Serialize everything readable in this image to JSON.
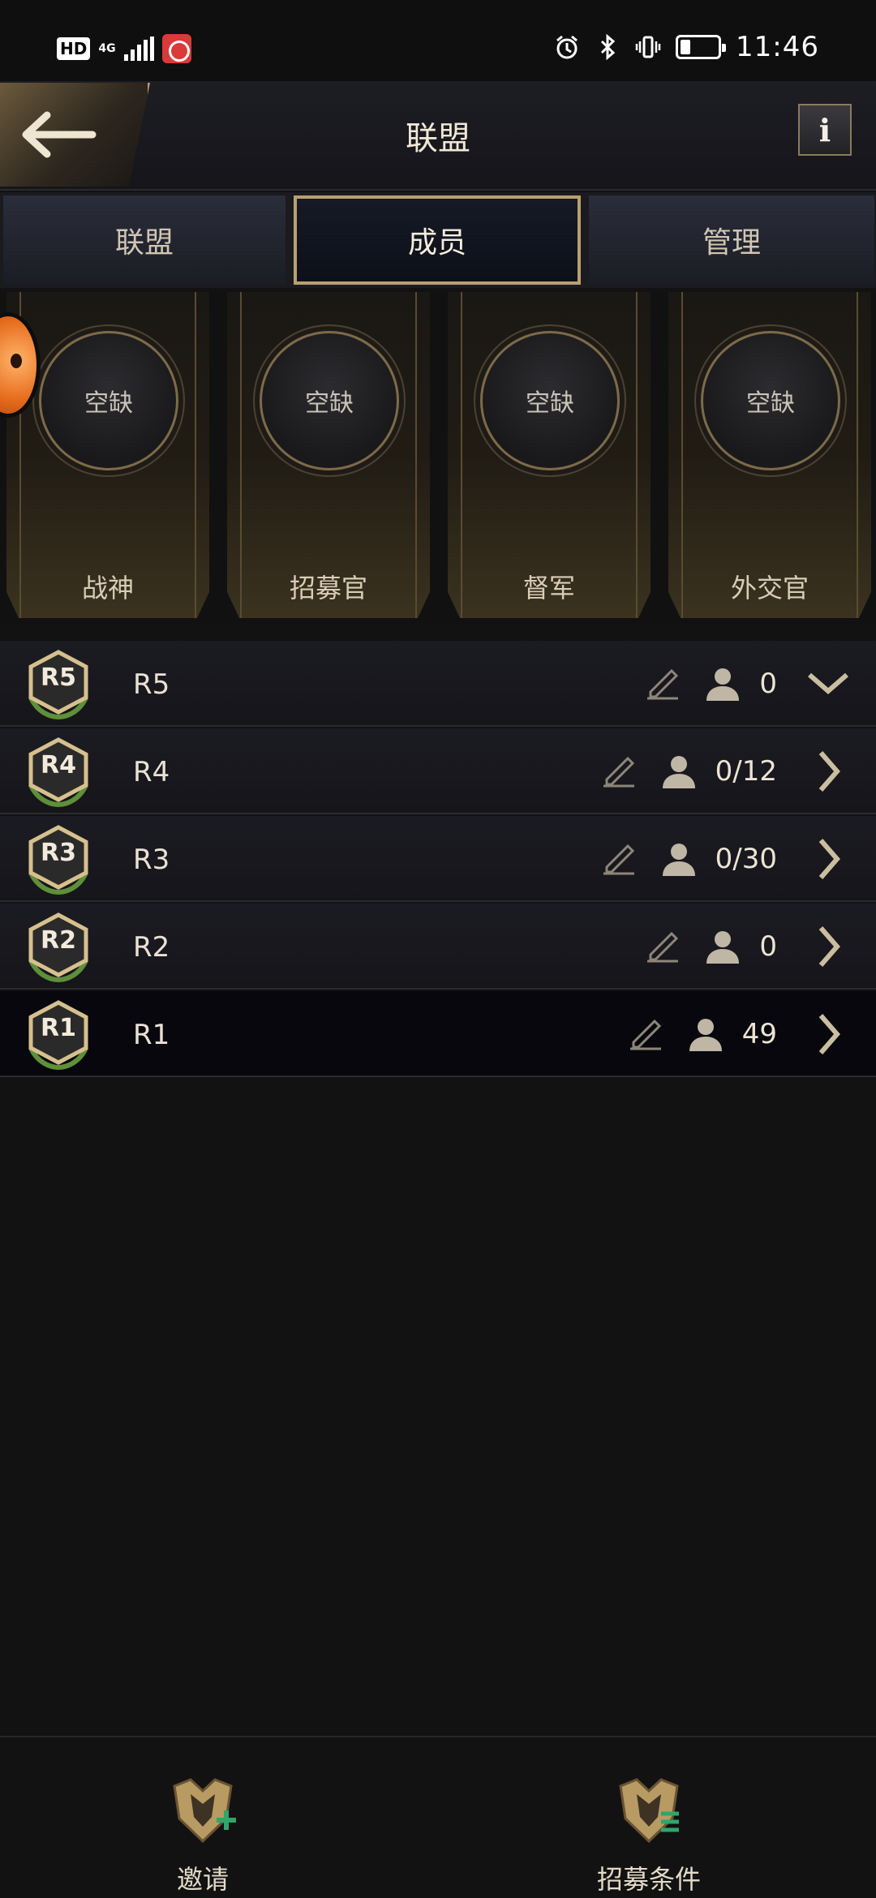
{
  "status_bar": {
    "hd": "HD",
    "network": "4G",
    "time": "11:46",
    "battery_level_percent": 20
  },
  "header": {
    "title": "联盟",
    "back_icon": "back-arrow-icon",
    "info_label": "i"
  },
  "tabs": [
    {
      "label": "联盟",
      "active": false
    },
    {
      "label": "成员",
      "active": true
    },
    {
      "label": "管理",
      "active": false
    }
  ],
  "officers": [
    {
      "status": "空缺",
      "role": "战神"
    },
    {
      "status": "空缺",
      "role": "招募官"
    },
    {
      "status": "空缺",
      "role": "督军"
    },
    {
      "status": "空缺",
      "role": "外交官"
    }
  ],
  "ranks": [
    {
      "badge": "R5",
      "name": "R5",
      "count": "0",
      "expanded": true
    },
    {
      "badge": "R4",
      "name": "R4",
      "count": "0/12",
      "expanded": false
    },
    {
      "badge": "R3",
      "name": "R3",
      "count": "0/30",
      "expanded": false
    },
    {
      "badge": "R2",
      "name": "R2",
      "count": "0",
      "expanded": false
    },
    {
      "badge": "R1",
      "name": "R1",
      "count": "49",
      "expanded": false
    }
  ],
  "bottom": {
    "invite_label": "邀请",
    "recruit_label": "招募条件"
  },
  "colors": {
    "background": "#121212",
    "gold_accent": "#b9a070",
    "text": "#e6dccb"
  }
}
